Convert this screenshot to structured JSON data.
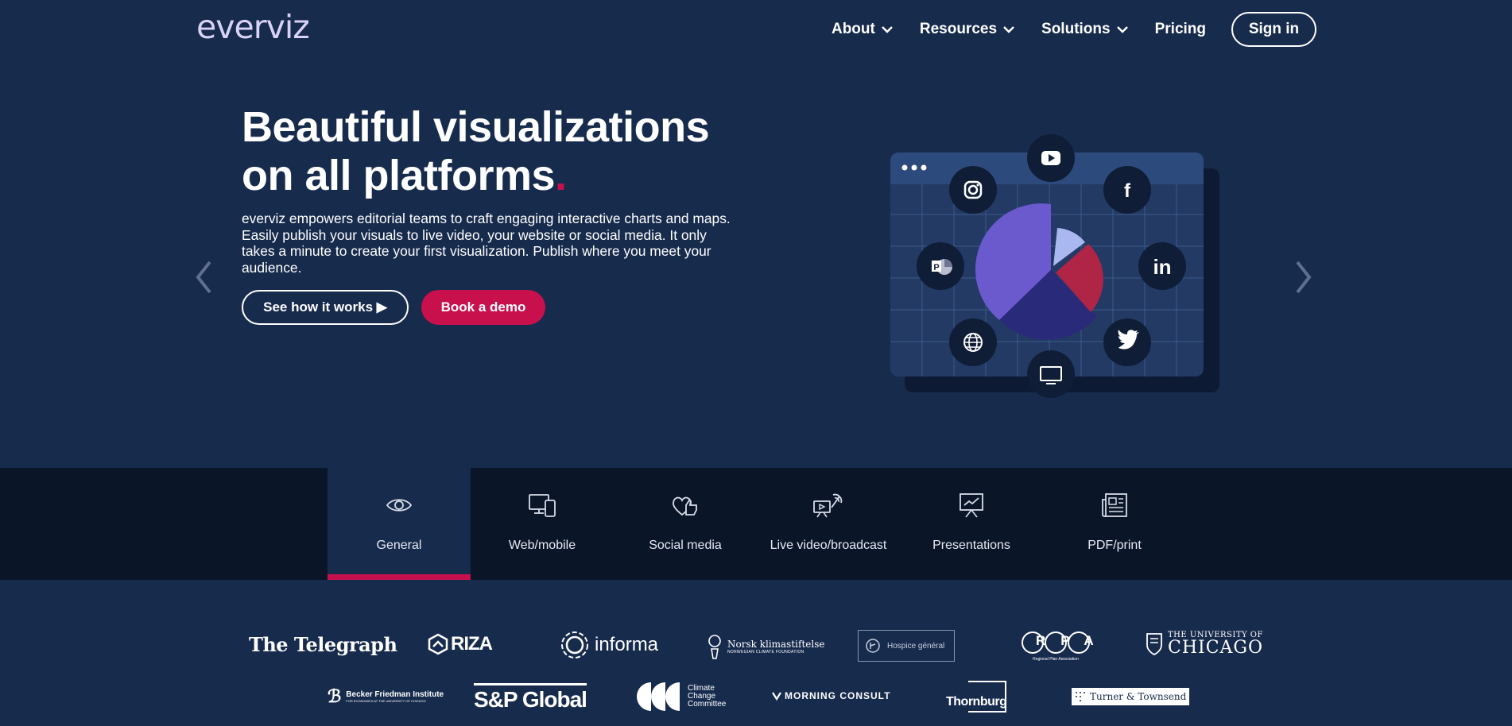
{
  "header": {
    "logo": "everviz",
    "nav": [
      {
        "label": "About",
        "dropdown": true
      },
      {
        "label": "Resources",
        "dropdown": true
      },
      {
        "label": "Solutions",
        "dropdown": true
      },
      {
        "label": "Pricing",
        "dropdown": false
      }
    ],
    "signin": "Sign in"
  },
  "hero": {
    "title_line1": "Beautiful visualizations",
    "title_line2": "on all platforms",
    "title_dot": ".",
    "description": "everviz empowers editorial teams to craft engaging interactive charts and maps. Easily publish your visuals to live video, your website or social media. It only takes a minute to create your first visualization. Publish where you meet your audience.",
    "cta_primary": "See how it works ▶",
    "cta_secondary": "Book a demo"
  },
  "illustration": {
    "platform_icons": [
      "youtube-icon",
      "instagram-icon",
      "facebook-icon",
      "powerpoint-icon",
      "linkedin-icon",
      "globe-icon",
      "twitter-icon",
      "tv-icon"
    ],
    "pie_colors": [
      "#6a5acd",
      "#2a2a7a",
      "#b02445",
      "#aab8f0"
    ]
  },
  "tabs": [
    {
      "label": "General",
      "icon": "eye-icon",
      "active": true
    },
    {
      "label": "Web/mobile",
      "icon": "devices-icon",
      "active": false
    },
    {
      "label": "Social media",
      "icon": "thumbs-up-icon",
      "active": false
    },
    {
      "label": "Live video/broadcast",
      "icon": "broadcast-icon",
      "active": false
    },
    {
      "label": "Presentations",
      "icon": "presentation-icon",
      "active": false
    },
    {
      "label": "PDF/print",
      "icon": "newspaper-icon",
      "active": false
    }
  ],
  "clients": {
    "row1": [
      "The Telegraph",
      "RIZA",
      "informa",
      "Norsk klimastiftelse",
      "Hospice général",
      "RPA",
      "THE UNIVERSITY OF CHICAGO"
    ],
    "row2": [
      "Becker Friedman Institute",
      "S&P Global",
      "Climate Change Committee",
      "MORNING CONSULT",
      "Thornburg",
      "Turner & Townsend"
    ],
    "norsk_sub": "NORWEGIAN CLIMATE FOUNDATION",
    "rpa_sub": "Regional Plan Association",
    "uchicago_line1": "THE UNIVERSITY OF",
    "uchicago_line2": "CHICAGO",
    "becker_sub": "FOR ECONOMICS AT THE UNIVERSITY OF CHICAGO",
    "ccc_lines": [
      "Climate",
      "Change",
      "Committee"
    ]
  },
  "colors": {
    "background": "#172b4d",
    "accent": "#c8104d",
    "band": "#0a1628"
  }
}
